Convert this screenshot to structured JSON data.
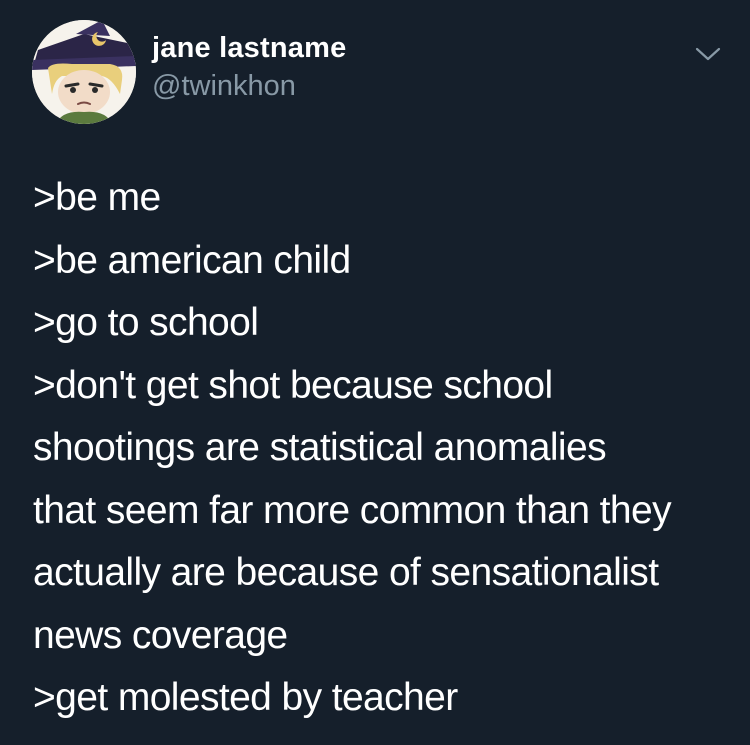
{
  "user": {
    "display_name": "jane lastname",
    "handle": "@twinkhon",
    "avatar_icon": "avatar-icon"
  },
  "tweet": {
    "lines": [
      ">be me",
      ">be american child",
      ">go to school",
      ">don't get shot because school",
      "shootings are statistical anomalies",
      "that seem far more common than they",
      "actually are because of sensationalist",
      "news coverage",
      ">get molested by teacher"
    ]
  },
  "menu": {
    "icon": "chevron-down-icon"
  },
  "colors": {
    "background": "#151f2b",
    "text": "#ffffff",
    "secondary_text": "#8899a6"
  }
}
